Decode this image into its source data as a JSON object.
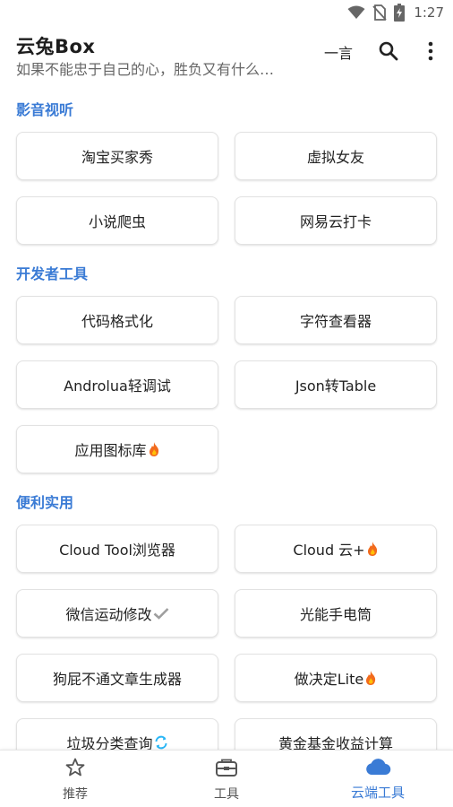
{
  "status_bar": {
    "time": "1:27",
    "icons": [
      "wifi-icon",
      "no-sim-icon",
      "battery-charging-icon"
    ]
  },
  "header": {
    "title": "云兔Box",
    "subtitle": "如果不能忠于自己的心，胜负又有什么…",
    "actions": {
      "yiyan": "一言",
      "search_icon": "search-icon",
      "more_icon": "more-vert-icon"
    }
  },
  "sections": [
    {
      "title": "影音视听",
      "items": [
        {
          "label": "淘宝买家秀"
        },
        {
          "label": "虚拟女友"
        },
        {
          "label": "小说爬虫"
        },
        {
          "label": "网易云打卡"
        }
      ]
    },
    {
      "title": "开发者工具",
      "items": [
        {
          "label": "代码格式化"
        },
        {
          "label": "字符查看器"
        },
        {
          "label": "Androlua轻调试"
        },
        {
          "label": "Json转Table"
        },
        {
          "label": "应用图标库",
          "badge": "fire-icon"
        }
      ]
    },
    {
      "title": "便利实用",
      "items": [
        {
          "label": "Cloud Tool浏览器"
        },
        {
          "label": "Cloud 云+",
          "badge": "fire-icon"
        },
        {
          "label": "微信运动修改",
          "badge": "check-icon"
        },
        {
          "label": "光能手电筒"
        },
        {
          "label": "狗屁不通文章生成器"
        },
        {
          "label": "做决定Lite",
          "badge": "fire-icon"
        },
        {
          "label": "垃圾分类查询",
          "badge": "refresh-icon"
        },
        {
          "label": "黄金基金收益计算"
        }
      ]
    }
  ],
  "bottom_nav": [
    {
      "label": "推荐",
      "icon": "star-icon",
      "active": false
    },
    {
      "label": "工具",
      "icon": "toolbox-icon",
      "active": false
    },
    {
      "label": "云端工具",
      "icon": "cloud-icon",
      "active": true
    }
  ],
  "colors": {
    "accent": "#3a7bd5",
    "fire": "#f26b1d",
    "check": "#9e9e9e",
    "refresh": "#29b6f6"
  }
}
